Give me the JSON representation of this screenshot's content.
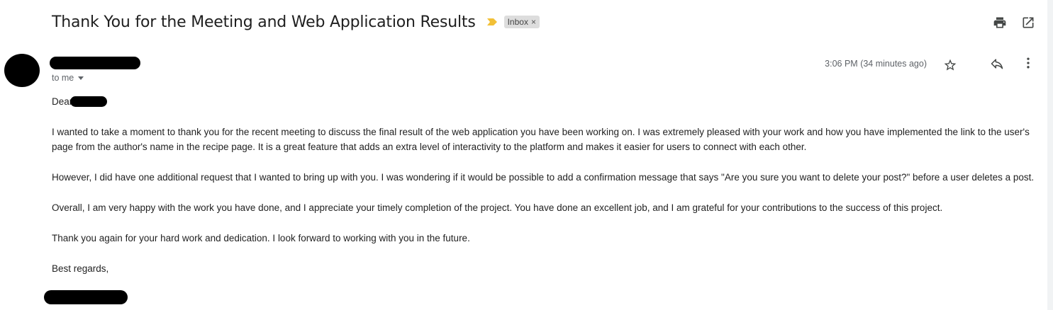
{
  "email": {
    "subject": "Thank You for the Meeting and Web Application Results",
    "label": "Inbox",
    "label_remove": "×",
    "recipient": "to me",
    "timestamp": "3:06 PM (34 minutes ago)",
    "greeting": "Dear",
    "paragraphs": [
      "I wanted to take a moment to thank you for the recent meeting to discuss the final result of the web application you have been working on. I was extremely pleased with your work and how you have implemented the link to the user's page from the author's name in the recipe page. It is a great feature that adds an extra level of interactivity to the platform and makes it easier for users to connect with each other.",
      "However, I did have one additional request that I wanted to bring up with you. I was wondering if it would be possible to add a confirmation message that says \"Are you sure you want to delete your post?\" before a user deletes a post.",
      "Overall, I am very happy with the work you have done, and I appreciate your timely completion of the project. You have done an excellent job, and I am grateful for your contributions to the success of this project.",
      "Thank you again for your hard work and dedication. I look forward to working with you in the future."
    ],
    "closing": "Best regards,"
  },
  "icons": {
    "importance": "importance-marker-icon",
    "print": "print-icon",
    "open_new_window": "open-in-new-window-icon",
    "star": "star-icon",
    "reply": "reply-icon",
    "more": "more-vertical-icon",
    "recipient_details": "chevron-down-icon"
  },
  "colors": {
    "importance_marker": "#f2c037",
    "label_chip_bg": "#dddddd",
    "secondary_text": "#5f6368",
    "redaction": "#000000"
  }
}
